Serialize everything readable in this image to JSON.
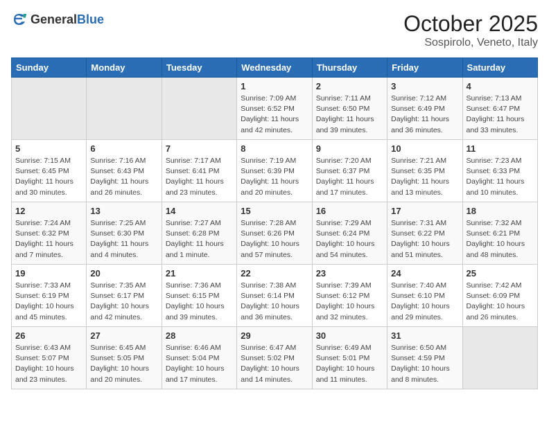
{
  "header": {
    "logo_general": "General",
    "logo_blue": "Blue",
    "month": "October 2025",
    "location": "Sospirolo, Veneto, Italy"
  },
  "days_of_week": [
    "Sunday",
    "Monday",
    "Tuesday",
    "Wednesday",
    "Thursday",
    "Friday",
    "Saturday"
  ],
  "weeks": [
    [
      {
        "day": "",
        "info": ""
      },
      {
        "day": "",
        "info": ""
      },
      {
        "day": "",
        "info": ""
      },
      {
        "day": "1",
        "info": "Sunrise: 7:09 AM\nSunset: 6:52 PM\nDaylight: 11 hours and 42 minutes."
      },
      {
        "day": "2",
        "info": "Sunrise: 7:11 AM\nSunset: 6:50 PM\nDaylight: 11 hours and 39 minutes."
      },
      {
        "day": "3",
        "info": "Sunrise: 7:12 AM\nSunset: 6:49 PM\nDaylight: 11 hours and 36 minutes."
      },
      {
        "day": "4",
        "info": "Sunrise: 7:13 AM\nSunset: 6:47 PM\nDaylight: 11 hours and 33 minutes."
      }
    ],
    [
      {
        "day": "5",
        "info": "Sunrise: 7:15 AM\nSunset: 6:45 PM\nDaylight: 11 hours and 30 minutes."
      },
      {
        "day": "6",
        "info": "Sunrise: 7:16 AM\nSunset: 6:43 PM\nDaylight: 11 hours and 26 minutes."
      },
      {
        "day": "7",
        "info": "Sunrise: 7:17 AM\nSunset: 6:41 PM\nDaylight: 11 hours and 23 minutes."
      },
      {
        "day": "8",
        "info": "Sunrise: 7:19 AM\nSunset: 6:39 PM\nDaylight: 11 hours and 20 minutes."
      },
      {
        "day": "9",
        "info": "Sunrise: 7:20 AM\nSunset: 6:37 PM\nDaylight: 11 hours and 17 minutes."
      },
      {
        "day": "10",
        "info": "Sunrise: 7:21 AM\nSunset: 6:35 PM\nDaylight: 11 hours and 13 minutes."
      },
      {
        "day": "11",
        "info": "Sunrise: 7:23 AM\nSunset: 6:33 PM\nDaylight: 11 hours and 10 minutes."
      }
    ],
    [
      {
        "day": "12",
        "info": "Sunrise: 7:24 AM\nSunset: 6:32 PM\nDaylight: 11 hours and 7 minutes."
      },
      {
        "day": "13",
        "info": "Sunrise: 7:25 AM\nSunset: 6:30 PM\nDaylight: 11 hours and 4 minutes."
      },
      {
        "day": "14",
        "info": "Sunrise: 7:27 AM\nSunset: 6:28 PM\nDaylight: 11 hours and 1 minute."
      },
      {
        "day": "15",
        "info": "Sunrise: 7:28 AM\nSunset: 6:26 PM\nDaylight: 10 hours and 57 minutes."
      },
      {
        "day": "16",
        "info": "Sunrise: 7:29 AM\nSunset: 6:24 PM\nDaylight: 10 hours and 54 minutes."
      },
      {
        "day": "17",
        "info": "Sunrise: 7:31 AM\nSunset: 6:22 PM\nDaylight: 10 hours and 51 minutes."
      },
      {
        "day": "18",
        "info": "Sunrise: 7:32 AM\nSunset: 6:21 PM\nDaylight: 10 hours and 48 minutes."
      }
    ],
    [
      {
        "day": "19",
        "info": "Sunrise: 7:33 AM\nSunset: 6:19 PM\nDaylight: 10 hours and 45 minutes."
      },
      {
        "day": "20",
        "info": "Sunrise: 7:35 AM\nSunset: 6:17 PM\nDaylight: 10 hours and 42 minutes."
      },
      {
        "day": "21",
        "info": "Sunrise: 7:36 AM\nSunset: 6:15 PM\nDaylight: 10 hours and 39 minutes."
      },
      {
        "day": "22",
        "info": "Sunrise: 7:38 AM\nSunset: 6:14 PM\nDaylight: 10 hours and 36 minutes."
      },
      {
        "day": "23",
        "info": "Sunrise: 7:39 AM\nSunset: 6:12 PM\nDaylight: 10 hours and 32 minutes."
      },
      {
        "day": "24",
        "info": "Sunrise: 7:40 AM\nSunset: 6:10 PM\nDaylight: 10 hours and 29 minutes."
      },
      {
        "day": "25",
        "info": "Sunrise: 7:42 AM\nSunset: 6:09 PM\nDaylight: 10 hours and 26 minutes."
      }
    ],
    [
      {
        "day": "26",
        "info": "Sunrise: 6:43 AM\nSunset: 5:07 PM\nDaylight: 10 hours and 23 minutes."
      },
      {
        "day": "27",
        "info": "Sunrise: 6:45 AM\nSunset: 5:05 PM\nDaylight: 10 hours and 20 minutes."
      },
      {
        "day": "28",
        "info": "Sunrise: 6:46 AM\nSunset: 5:04 PM\nDaylight: 10 hours and 17 minutes."
      },
      {
        "day": "29",
        "info": "Sunrise: 6:47 AM\nSunset: 5:02 PM\nDaylight: 10 hours and 14 minutes."
      },
      {
        "day": "30",
        "info": "Sunrise: 6:49 AM\nSunset: 5:01 PM\nDaylight: 10 hours and 11 minutes."
      },
      {
        "day": "31",
        "info": "Sunrise: 6:50 AM\nSunset: 4:59 PM\nDaylight: 10 hours and 8 minutes."
      },
      {
        "day": "",
        "info": ""
      }
    ]
  ]
}
